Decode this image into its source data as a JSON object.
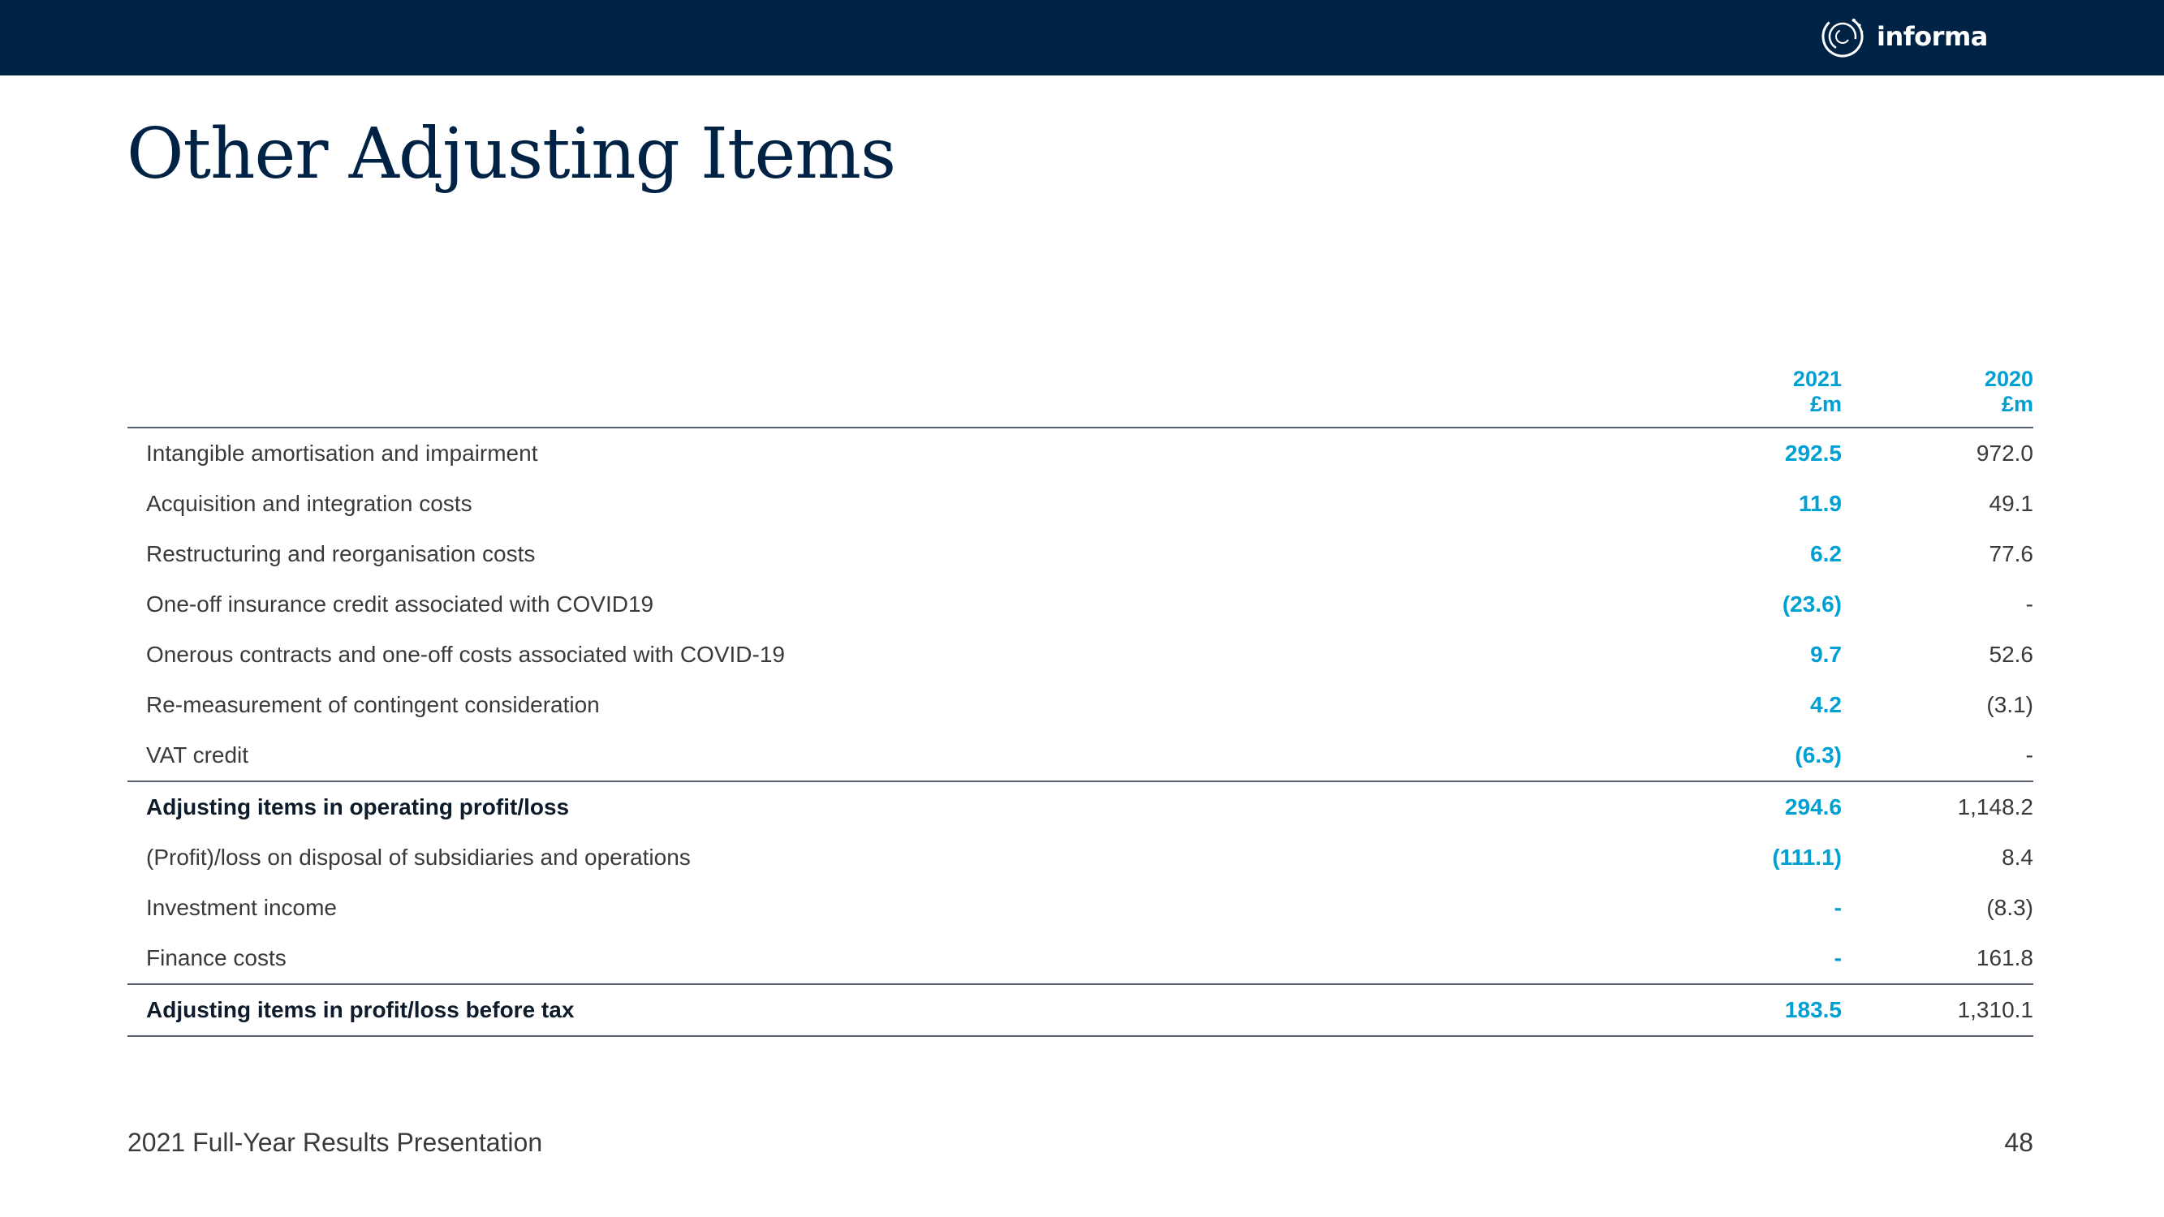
{
  "brand": {
    "name": "informa",
    "bar_color": "#002345",
    "accent": "#00a0d2"
  },
  "title": "Other Adjusting Items",
  "table": {
    "columns": [
      {
        "year": "2021",
        "unit": "£m"
      },
      {
        "year": "2020",
        "unit": "£m"
      }
    ],
    "rows": [
      {
        "label": "Intangible amortisation and impairment",
        "v2021": "292.5",
        "v2020": "972.0"
      },
      {
        "label": "Acquisition and integration costs",
        "v2021": "11.9",
        "v2020": "49.1"
      },
      {
        "label": "Restructuring and reorganisation costs",
        "v2021": "6.2",
        "v2020": "77.6"
      },
      {
        "label": "One-off insurance credit associated with COVID19",
        "v2021": "(23.6)",
        "v2020": "-"
      },
      {
        "label": "Onerous contracts and one-off costs associated with COVID-19",
        "v2021": "9.7",
        "v2020": "52.6"
      },
      {
        "label": "Re-measurement of contingent consideration",
        "v2021": "4.2",
        "v2020": "(3.1)"
      },
      {
        "label": "VAT credit",
        "v2021": "(6.3)",
        "v2020": "-"
      },
      {
        "label": "Adjusting items in operating profit/loss",
        "v2021": "294.6",
        "v2020": "1,148.2",
        "total": true
      },
      {
        "label": "(Profit)/loss on disposal of subsidiaries and operations",
        "v2021": "(111.1)",
        "v2020": "8.4"
      },
      {
        "label": "Investment income",
        "v2021": "-",
        "v2020": "(8.3)"
      },
      {
        "label": "Finance costs",
        "v2021": "-",
        "v2020": "161.8"
      },
      {
        "label": "Adjusting items in profit/loss before tax",
        "v2021": "183.5",
        "v2020": "1,310.1",
        "total": true
      }
    ]
  },
  "footer": {
    "presentation": "2021 Full-Year Results Presentation",
    "page_number": "48"
  }
}
